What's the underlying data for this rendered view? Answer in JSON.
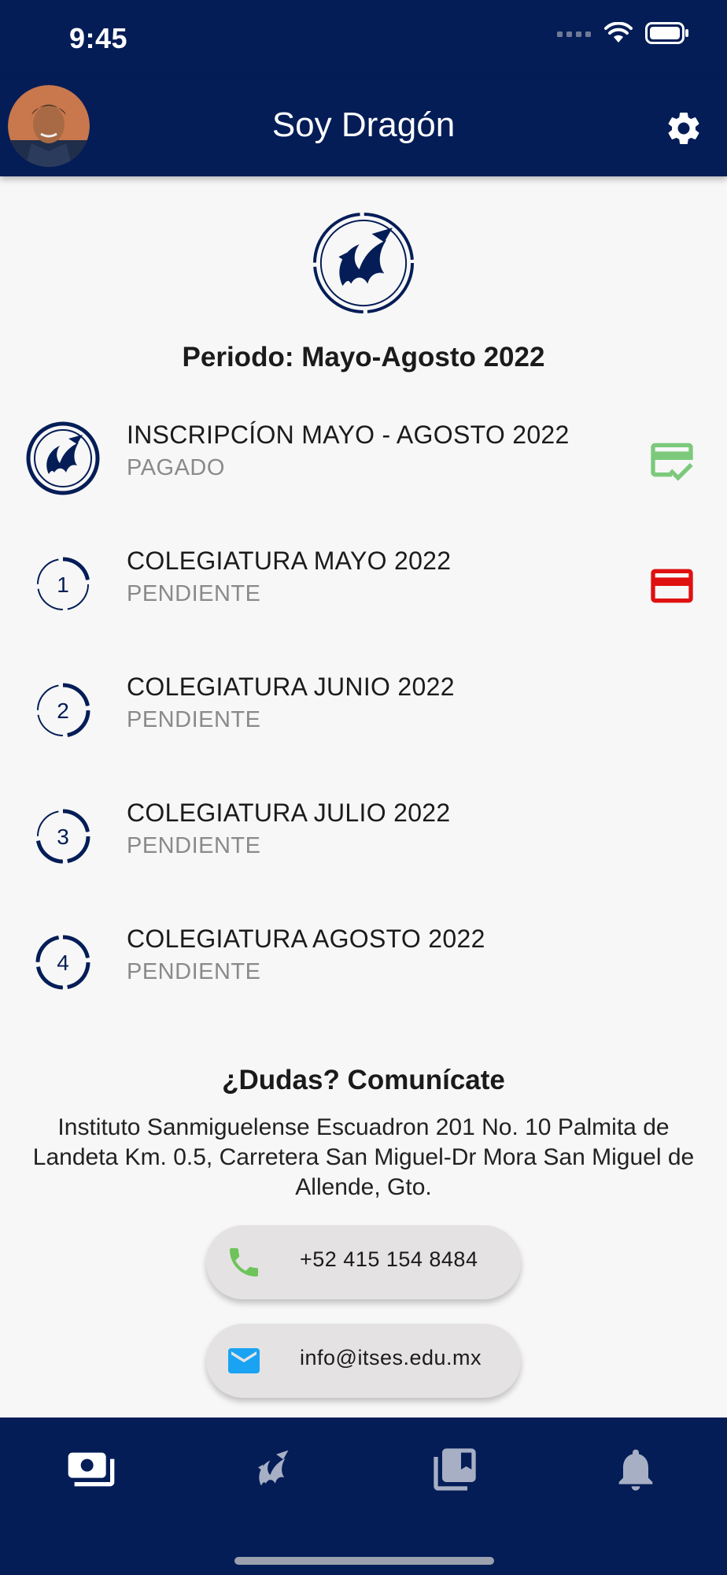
{
  "status_bar": {
    "time": "9:45"
  },
  "app_bar": {
    "title": "Soy Dragón"
  },
  "period": {
    "label": "Periodo: Mayo-Agosto 2022"
  },
  "payments": [
    {
      "title": "INSCRIPCÍON MAYO - AGOSTO 2022",
      "status": "PAGADO",
      "lead_icon": "dragon-logo-icon",
      "trail_icon": "card-check-icon",
      "trail_color": "#7cc97c"
    },
    {
      "title": "COLEGIATURA MAYO 2022",
      "status": "PENDIENTE",
      "number": "1",
      "progress": 0.25,
      "trail_icon": "credit-card-icon",
      "trail_color": "#e01010"
    },
    {
      "title": "COLEGIATURA JUNIO 2022",
      "status": "PENDIENTE",
      "number": "2",
      "progress": 0.5
    },
    {
      "title": "COLEGIATURA JULIO 2022",
      "status": "PENDIENTE",
      "number": "3",
      "progress": 0.75
    },
    {
      "title": "COLEGIATURA AGOSTO 2022",
      "status": "PENDIENTE",
      "number": "4",
      "progress": 1.0
    }
  ],
  "contact": {
    "title": "¿Dudas? Comunícate",
    "address": "Instituto Sanmiguelense Escuadron 201 No. 10 Palmita de Landeta Km. 0.5, Carretera San Miguel-Dr Mora San Miguel de Allende, Gto.",
    "phone": "+52 415 154 8484",
    "email": "info@itses.edu.mx"
  },
  "bottom_nav": [
    {
      "icon": "payments-icon",
      "active": true
    },
    {
      "icon": "dragon-icon",
      "active": false
    },
    {
      "icon": "library-icon",
      "active": false
    },
    {
      "icon": "bell-icon",
      "active": false
    }
  ],
  "colors": {
    "primary": "#041d57",
    "paid_icon": "#7cc97c",
    "pending_icon": "#e01010",
    "phone_icon": "#6ec35a",
    "email_icon": "#1aa3f2"
  }
}
